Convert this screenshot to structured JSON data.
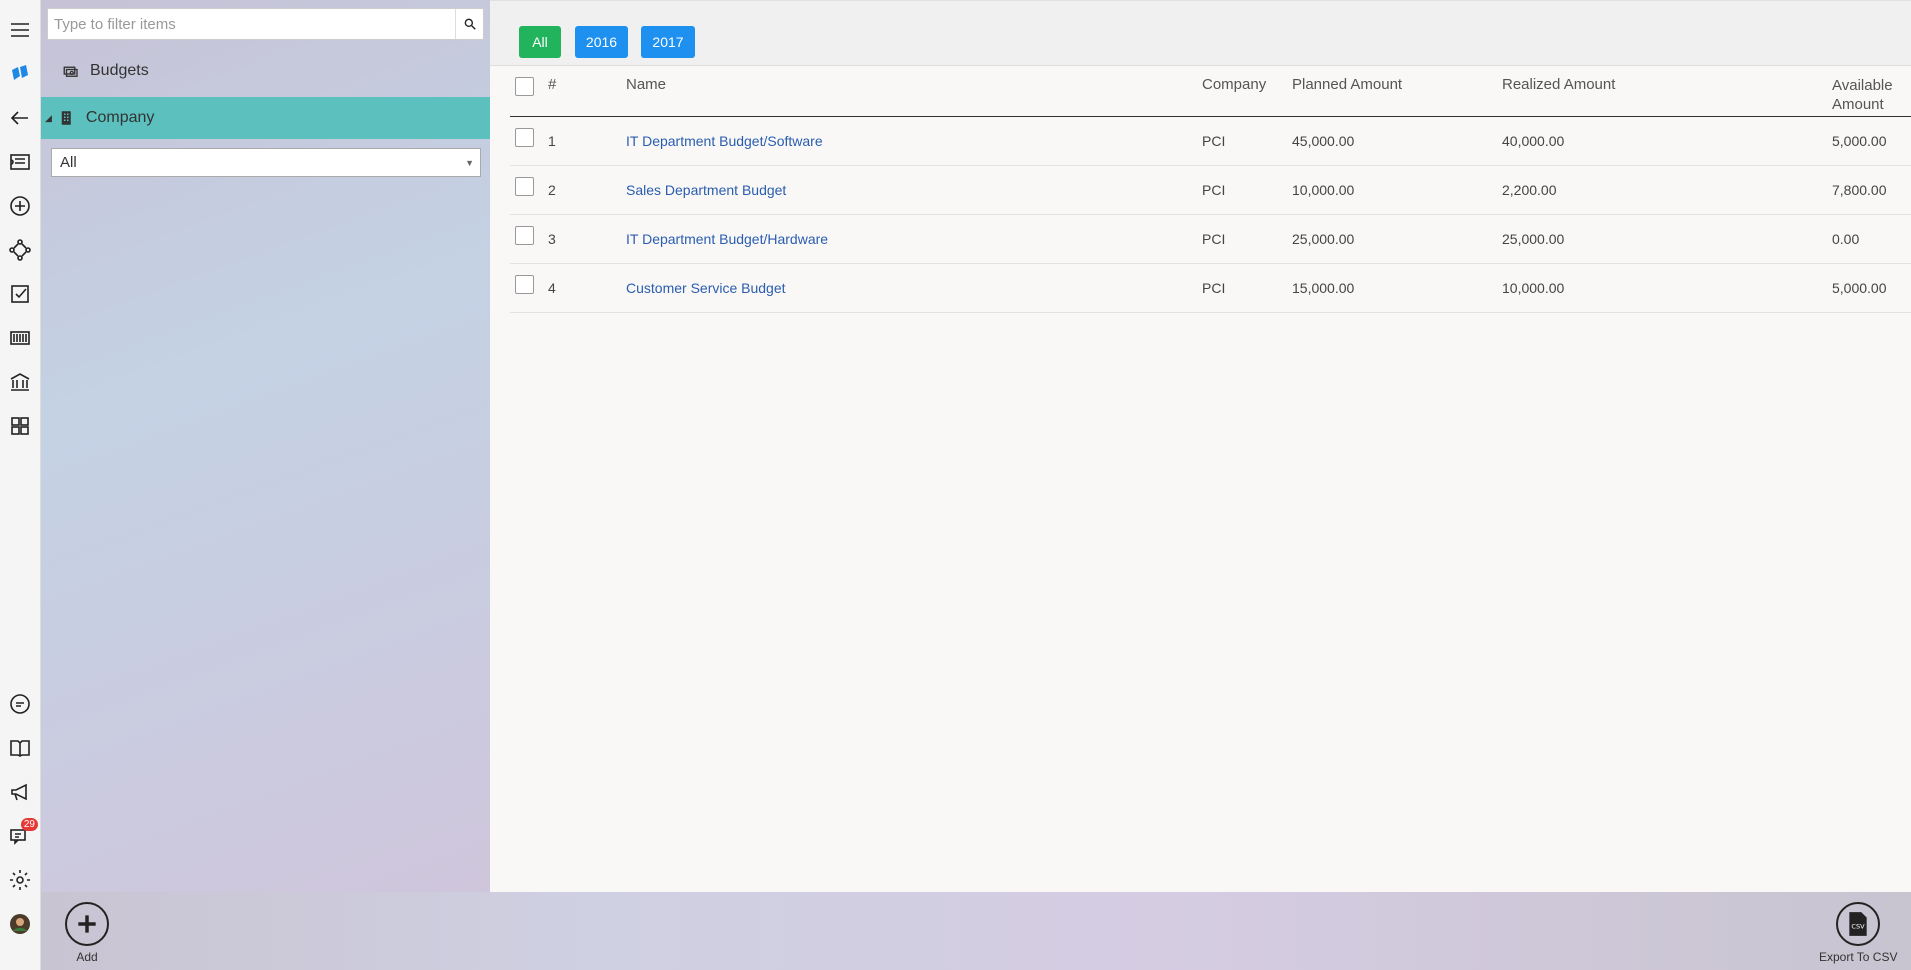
{
  "sidebar": {
    "filter_placeholder": "Type to filter items",
    "items": [
      {
        "label": "Budgets"
      },
      {
        "label": "Company"
      }
    ],
    "company_select": "All"
  },
  "toolbar": {
    "year_buttons": [
      "All",
      "2016",
      "2017"
    ]
  },
  "table": {
    "headers": [
      "#",
      "Name",
      "Company",
      "Planned Amount",
      "Realized Amount",
      "Available Amount"
    ],
    "rows": [
      {
        "num": "1",
        "name": "IT Department Budget/Software",
        "company": "PCI",
        "planned": "45,000.00",
        "realized": "40,000.00",
        "available": "5,000.00"
      },
      {
        "num": "2",
        "name": "Sales Department Budget",
        "company": "PCI",
        "planned": "10,000.00",
        "realized": "2,200.00",
        "available": "7,800.00"
      },
      {
        "num": "3",
        "name": "IT Department Budget/Hardware",
        "company": "PCI",
        "planned": "25,000.00",
        "realized": "25,000.00",
        "available": "0.00"
      },
      {
        "num": "4",
        "name": "Customer Service Budget",
        "company": "PCI",
        "planned": "15,000.00",
        "realized": "10,000.00",
        "available": "5,000.00"
      }
    ]
  },
  "rail": {
    "messages_badge": "29"
  },
  "bottom": {
    "add_label": "Add",
    "export_label": "Export To CSV",
    "csv_icon_text": "CSV"
  },
  "colors": {
    "active_nav": "#5bc0be",
    "all_button": "#22b45d",
    "year_button": "#1e90f0",
    "link": "#2a5db0"
  }
}
